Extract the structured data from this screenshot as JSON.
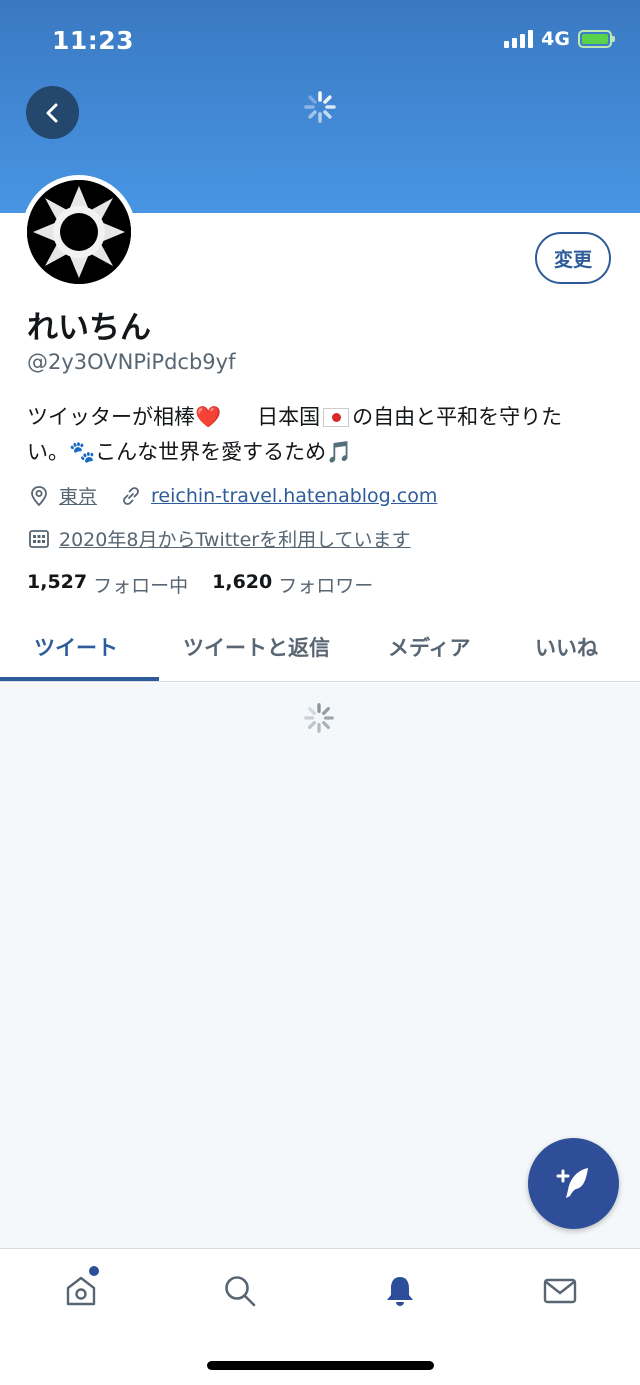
{
  "status_bar": {
    "time": "11:23",
    "network": "4G"
  },
  "profile": {
    "name": "れいちん",
    "handle": "@2y3OVNPiPdcb9yf",
    "edit_label": "変更",
    "bio_line1_a": "ツイッターが相棒",
    "bio_heart": "❤️",
    "bio_line1_b": "日本国",
    "bio_line1_c": "の自由と平和を守りた",
    "bio_line2": "い。🐾こんな世界を愛するため🎵",
    "location": "東京",
    "website": "reichin-travel.hatenablog.com",
    "joined": "2020年8月からTwitterを利用しています",
    "following_count": "1,527",
    "following_label": "フォロー中",
    "followers_count": "1,620",
    "followers_label": "フォロワー"
  },
  "tabs": [
    {
      "label": "ツイート"
    },
    {
      "label": "ツイートと返信"
    },
    {
      "label": "メディア"
    },
    {
      "label": "いいね"
    }
  ],
  "bottom_nav": [
    {
      "icon": "home-icon"
    },
    {
      "icon": "search-icon"
    },
    {
      "icon": "notifications-icon"
    },
    {
      "icon": "messages-icon"
    }
  ],
  "colors": {
    "accent": "#2e5c9a",
    "header_top": "#3a79c2",
    "header_bottom": "#4895e4",
    "fab": "#2e4e99"
  }
}
